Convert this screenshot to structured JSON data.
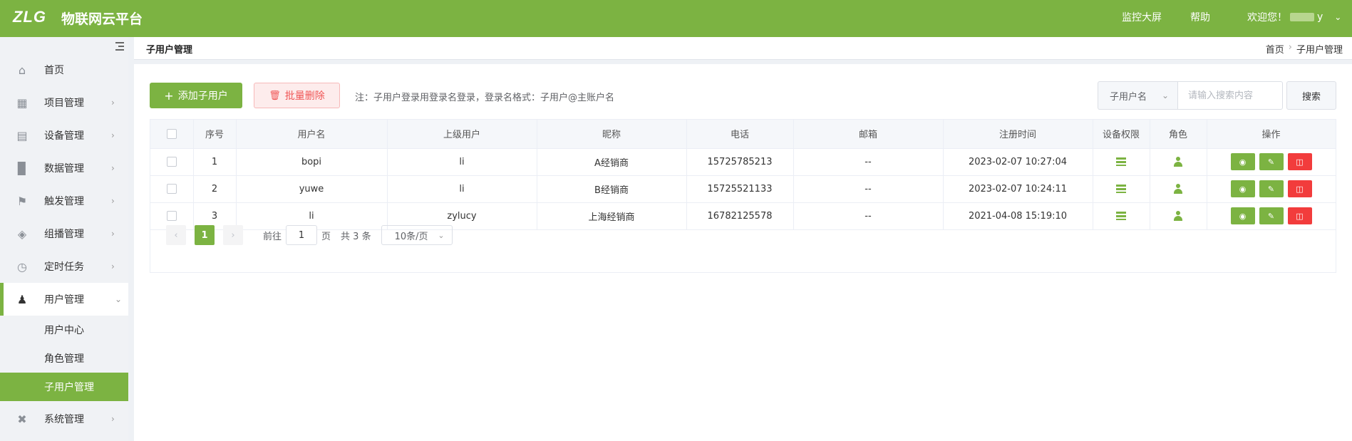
{
  "header": {
    "logo": "ZLG",
    "title": "物联网云平台",
    "links": [
      "监控大屏",
      "帮助"
    ],
    "welcome": "欢迎您！",
    "username_suffix": "y"
  },
  "sidebar": {
    "items": [
      {
        "label": "首页",
        "icon": "home-icon"
      },
      {
        "label": "项目管理",
        "icon": "project-icon"
      },
      {
        "label": "设备管理",
        "icon": "device-icon"
      },
      {
        "label": "数据管理",
        "icon": "chart-icon"
      },
      {
        "label": "触发管理",
        "icon": "flag-icon"
      },
      {
        "label": "组播管理",
        "icon": "layers-icon"
      },
      {
        "label": "定时任务",
        "icon": "clock-icon"
      },
      {
        "label": "用户管理",
        "icon": "user-settings-icon"
      },
      {
        "label": "系统管理",
        "icon": "tools-icon"
      }
    ],
    "sub_items": [
      "用户中心",
      "角色管理",
      "子用户管理"
    ]
  },
  "breadcrumb": {
    "page_title": "子用户管理",
    "home": "首页",
    "current": "子用户管理"
  },
  "toolbar": {
    "add_label": "添加子用户",
    "delete_label": "批量删除",
    "note": "注：子用户登录用登录名登录，登录名格式：子用户@主账户名",
    "search_field": "子用户名",
    "search_placeholder": "请输入搜索内容",
    "search_button": "搜索"
  },
  "table": {
    "columns": [
      "序号",
      "用户名",
      "上级用户",
      "昵称",
      "电话",
      "邮箱",
      "注册时间",
      "设备权限",
      "角色",
      "操作"
    ],
    "rows": [
      {
        "index": "1",
        "username": "bopi",
        "parent": "li",
        "nickname": "A经销商",
        "phone": "15725785213",
        "email": "--",
        "registered": "2023-02-07 10:27:04"
      },
      {
        "index": "2",
        "username": "yuwe",
        "parent": "li",
        "nickname": "B经销商",
        "phone": "15725521133",
        "email": "--",
        "registered": "2023-02-07 10:24:11"
      },
      {
        "index": "3",
        "username": "li",
        "parent": "zylucy",
        "nickname": "上海经销商",
        "phone": "16782125578",
        "email": "--",
        "registered": "2021-04-08 15:19:10"
      }
    ]
  },
  "pagination": {
    "current_page": "1",
    "goto_prefix": "前往",
    "goto_value": "1",
    "goto_suffix": "页",
    "total": "共 3 条",
    "page_size": "10条/页"
  },
  "colors": {
    "brand": "#7cb342",
    "danger": "#f23c3c"
  }
}
